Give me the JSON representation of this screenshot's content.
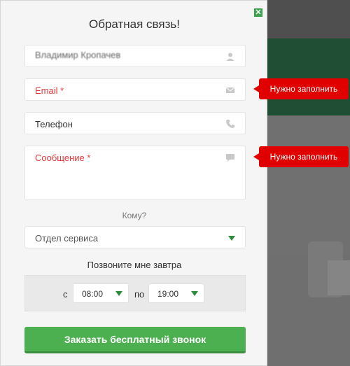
{
  "modal": {
    "title": "Обратная связь!",
    "close_icon": "close-icon",
    "name_value": "Владимир Кропачев",
    "email_placeholder": "Email *",
    "phone_placeholder": "Телефон",
    "message_placeholder": "Сообщение *",
    "to_label": "Кому?",
    "department_value": "Отдел сервиса",
    "callback_label": "Позвоните мне завтра",
    "from_word": "с",
    "from_time": "08:00",
    "to_word": "по",
    "to_time": "19:00",
    "submit_label": "Заказать бесплатный звонок"
  },
  "tooltips": {
    "email_error": "Нужно заполнить",
    "message_error": "Нужно заполнить"
  },
  "colors": {
    "accent_green": "#4caf50",
    "error_red": "#e00000",
    "required_text_red": "#e23b3b"
  },
  "icons": {
    "name": "user-icon",
    "email": "envelope-icon",
    "phone": "phone-icon",
    "message": "chat-bubble-icon",
    "dropdown": "chevron-down-icon"
  }
}
